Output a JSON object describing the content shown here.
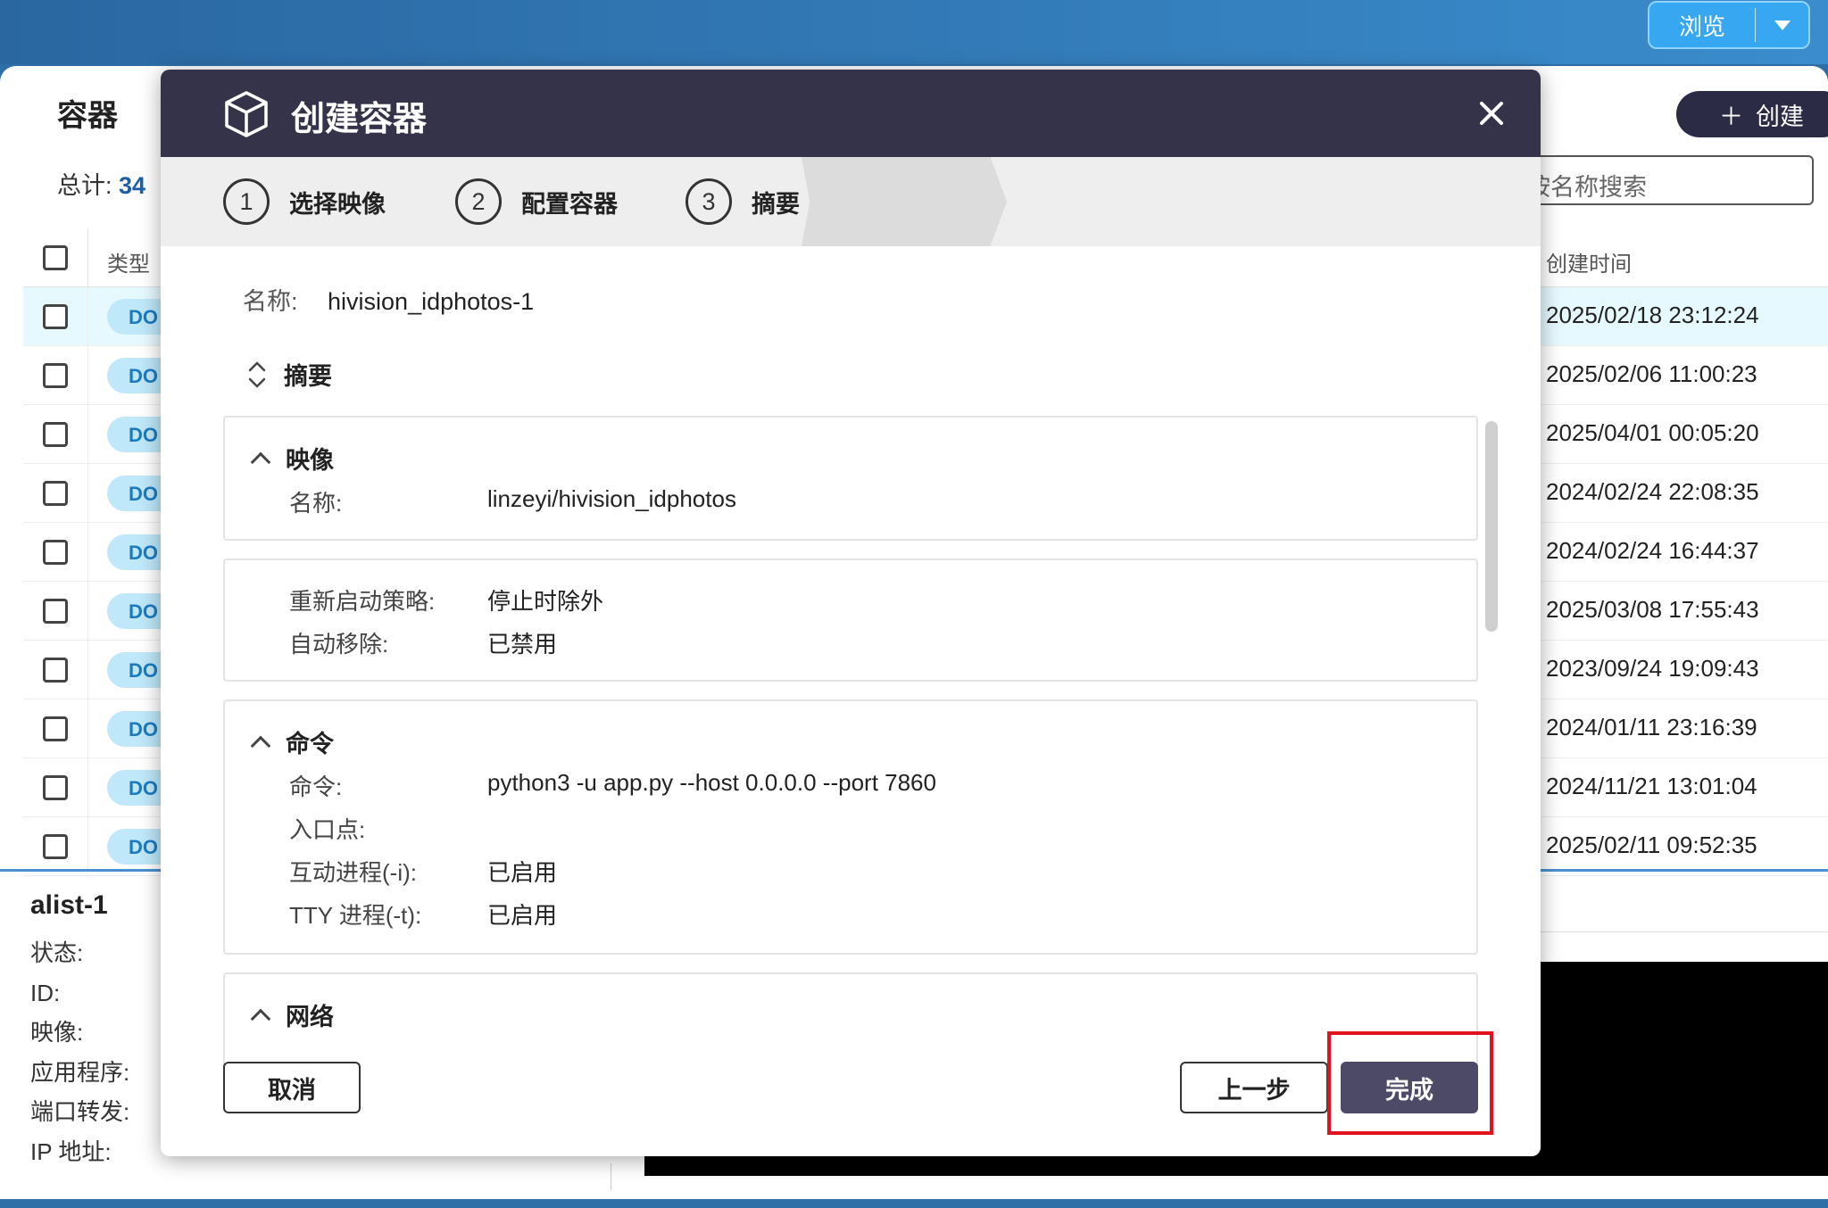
{
  "topbar": {
    "browse_label": "浏览"
  },
  "background": {
    "page_title": "容器",
    "total_label": "总计:",
    "total_count": "34",
    "create_label": "创建",
    "search_placeholder": "按名称搜索",
    "columns": {
      "type": "类型",
      "created": "创建时间"
    },
    "rows": [
      {
        "type": "DO",
        "created": "2025/02/18 23:12:24"
      },
      {
        "type": "DO",
        "created": "2025/02/06 11:00:23"
      },
      {
        "type": "DO",
        "created": "2025/04/01 00:05:20"
      },
      {
        "type": "DO",
        "created": "2024/02/24 22:08:35"
      },
      {
        "type": "DO",
        "created": "2024/02/24 16:44:37"
      },
      {
        "type": "DO",
        "created": "2025/03/08 17:55:43"
      },
      {
        "type": "DO",
        "created": "2023/09/24 19:09:43"
      },
      {
        "type": "DO",
        "created": "2024/01/11 23:16:39"
      },
      {
        "type": "DO",
        "created": "2024/11/21 13:01:04"
      },
      {
        "type": "DO",
        "created": "2025/02/11 09:52:35"
      }
    ],
    "detail": {
      "name": "alist-1",
      "labels": [
        "状态:",
        "ID:",
        "映像:",
        "应用程序:",
        "端口转发:",
        "IP 地址:"
      ]
    }
  },
  "modal": {
    "title": "创建容器",
    "steps": [
      {
        "num": "1",
        "label": "选择映像"
      },
      {
        "num": "2",
        "label": "配置容器"
      },
      {
        "num": "3",
        "label": "摘要"
      }
    ],
    "name_key": "名称:",
    "name_value": "hivision_idphotos-1",
    "summary_label": "摘要",
    "sections": {
      "image": {
        "title": "映像",
        "items": [
          {
            "k": "名称:",
            "v": "linzeyi/hivision_idphotos"
          }
        ]
      },
      "policy": {
        "items": [
          {
            "k": "重新启动策略:",
            "v": "停止时除外"
          },
          {
            "k": "自动移除:",
            "v": "已禁用"
          }
        ]
      },
      "command": {
        "title": "命令",
        "items": [
          {
            "k": "命令:",
            "v": "python3 -u app.py --host 0.0.0.0 --port 7860"
          },
          {
            "k": "入口点:",
            "v": ""
          },
          {
            "k": "互动进程(-i):",
            "v": "已启用"
          },
          {
            "k": "TTY 进程(-t):",
            "v": "已启用"
          }
        ]
      },
      "network": {
        "title": "网络"
      }
    },
    "buttons": {
      "cancel": "取消",
      "prev": "上一步",
      "finish": "完成"
    }
  },
  "colors": {
    "header": "#353349",
    "finish": "#4d4a68",
    "highlight": "#e0141e",
    "accent": "#1c5ea8"
  }
}
